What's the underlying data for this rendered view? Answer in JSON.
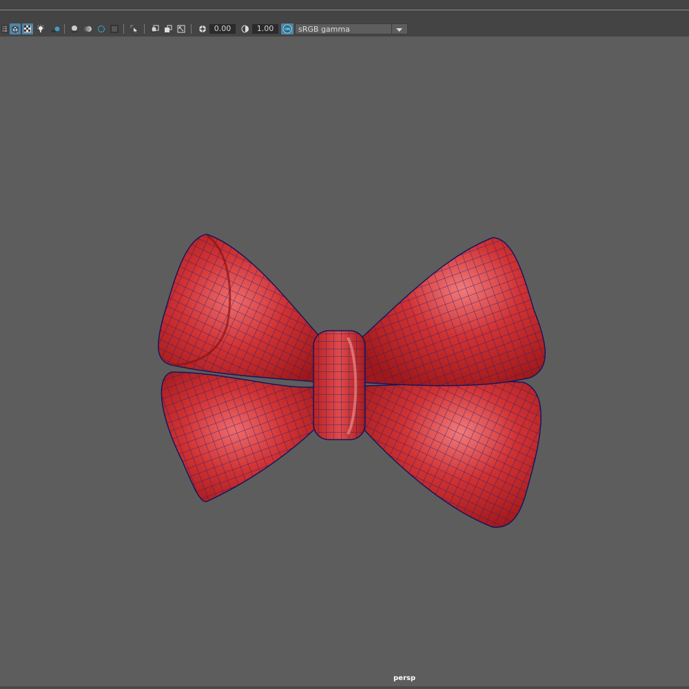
{
  "toolbar": {
    "icons": [
      "xray-joint-icon",
      "wireframe-shaded-icon",
      "texture-icon",
      "lights-icon",
      "shadows-icon",
      "ambient-occlusion-icon",
      "motion-blur-icon",
      "antialias-icon",
      "depth-of-field-icon",
      "isolate-select-icon",
      "xray-icon",
      "grid-icon",
      "resolution-gate-icon",
      "gate-mask-icon",
      "exposure-icon",
      "gamma-icon",
      "color-management-icon"
    ],
    "exposure_value": "0.00",
    "gamma_value": "1.00",
    "color_space": "sRGB gamma"
  },
  "viewport": {
    "camera": "persp",
    "background_color": "#5d5d5d",
    "model": {
      "name": "bow",
      "surface_color": "#cf2a2a",
      "wireframe_color": "#1b1b6e"
    }
  }
}
